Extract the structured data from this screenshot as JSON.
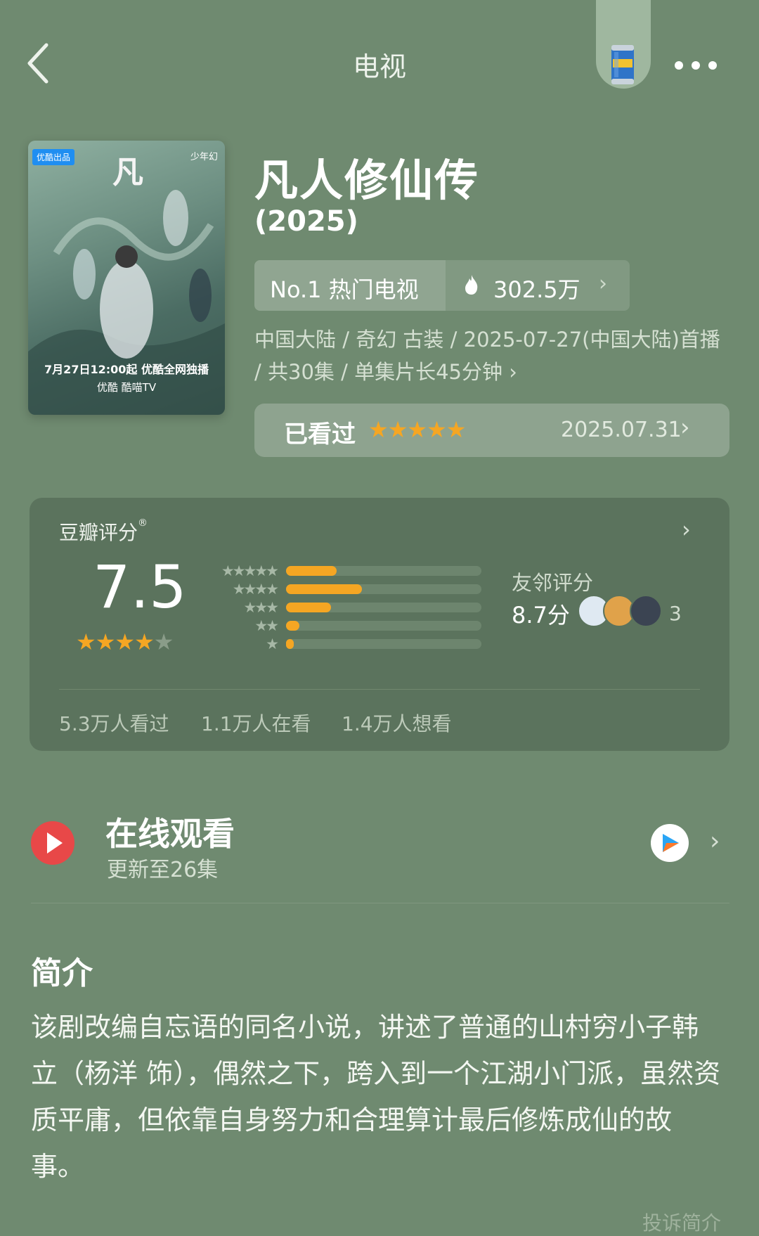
{
  "header": {
    "title": "电视"
  },
  "poster": {
    "badge": "优酷出品",
    "brand": "少年幻",
    "release_line": "7月27日12:00起 优酷全网独播",
    "platforms": "优酷  酷喵TV"
  },
  "show": {
    "title": "凡人修仙传",
    "year": "(2025)",
    "rank_label": "No.1 热门电视",
    "heat_value": "302.5万",
    "meta": "中国大陆 / 奇幻 古装 / 2025-07-27(中国大陆)首播 / 共30集 / 单集片长45分钟 ›"
  },
  "watched": {
    "label": "已看过",
    "stars": "★★★★★",
    "date": "2025.07.31"
  },
  "rating": {
    "label": "豆瓣评分",
    "trademark": "®",
    "score": "7.5",
    "stars_full": "★★★★",
    "stars_empty": "★",
    "distribution": [
      {
        "label": "★★★★★",
        "fraction": 0.26
      },
      {
        "label": "★★★★",
        "fraction": 0.39
      },
      {
        "label": "★★★",
        "fraction": 0.23
      },
      {
        "label": "★★",
        "fraction": 0.07
      },
      {
        "label": "★",
        "fraction": 0.04
      }
    ],
    "friend_label": "友邻评分",
    "friend_score": "8.7分",
    "friend_count": "3",
    "stats": [
      "5.3万人看过",
      "1.1万人在看",
      "1.4万人想看"
    ]
  },
  "watch_online": {
    "title": "在线观看",
    "subtitle": "更新至26集"
  },
  "synopsis": {
    "title": "简介",
    "text": "该剧改编自忘语的同名小说，讲述了普通的山村穷小子韩立（杨洋 饰），偶然之下，跨入到一个江湖小门派，虽然资质平庸，但依靠自身努力和合理算计最后修炼成仙的故事。",
    "report_label": "投诉简介"
  },
  "colors": {
    "background": "#6f8a70",
    "star": "#f5a623",
    "play": "#e84848"
  },
  "icons": [
    "back-icon",
    "beer-can-icon",
    "more-icon",
    "flame-icon",
    "play-icon",
    "youku-icon"
  ]
}
